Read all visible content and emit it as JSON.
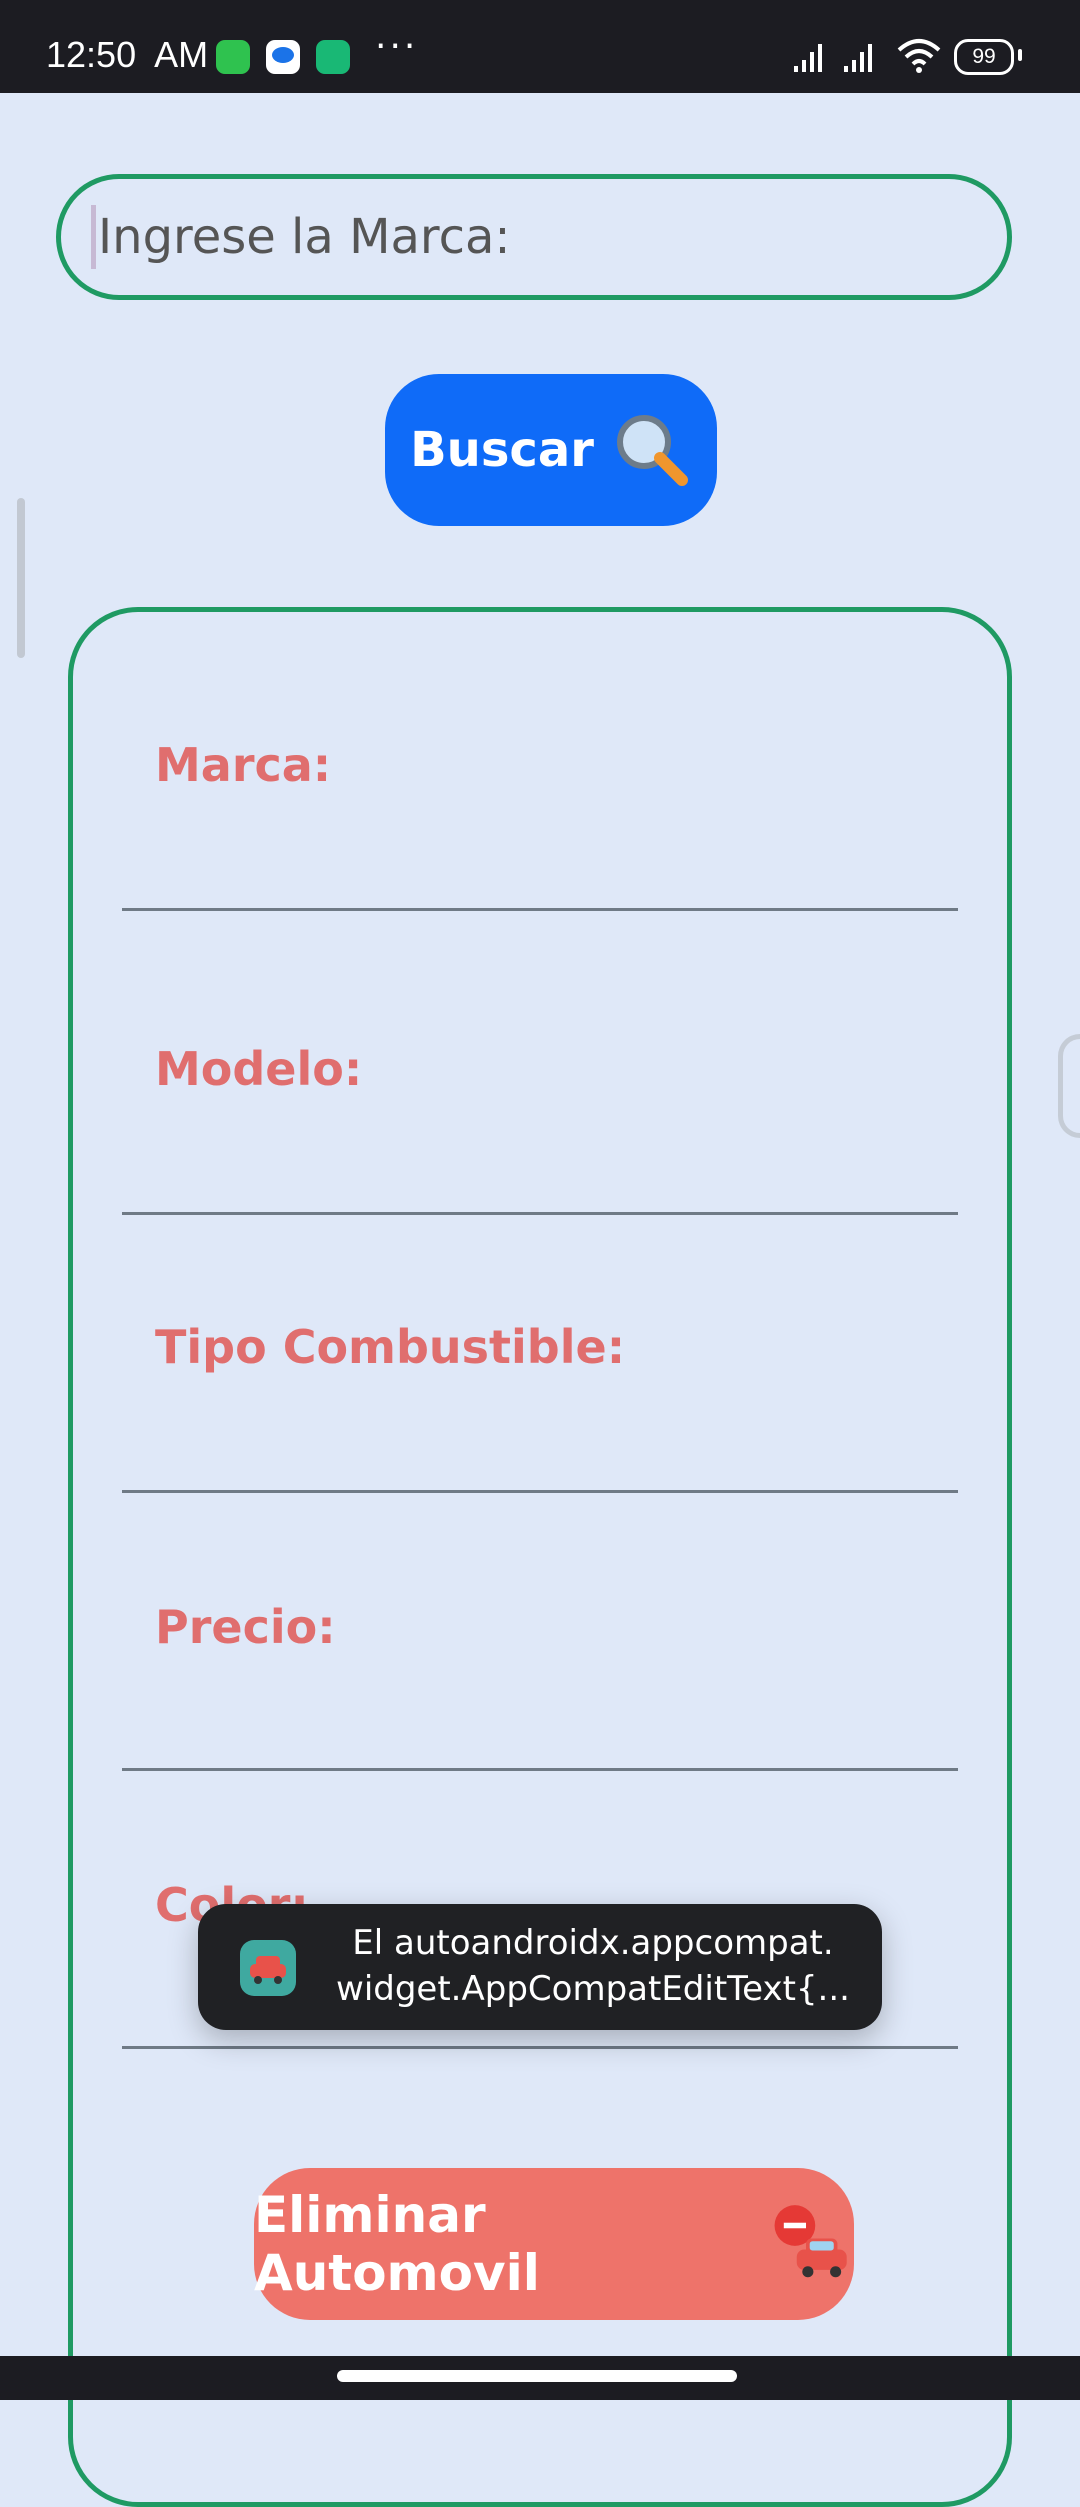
{
  "status_bar": {
    "time": "12:50",
    "ampm": "AM",
    "more": "···",
    "battery": "99"
  },
  "search": {
    "placeholder": "Ingrese la Marca:"
  },
  "buscar_button": {
    "label": "Buscar"
  },
  "fields": [
    {
      "label": "Marca:"
    },
    {
      "label": "Modelo:"
    },
    {
      "label": "Tipo Combustible:"
    },
    {
      "label": "Precio:"
    },
    {
      "label": "Color:"
    }
  ],
  "toast": {
    "line1": "El autoandroidx.appcompat.",
    "line2": "widget.AppCompatEditText{..."
  },
  "delete_button": {
    "label": "Eliminar Automovil"
  },
  "colors": {
    "accent_green": "#1f9a63",
    "button_blue": "#0f6bf8",
    "label_red": "#e06e6e",
    "delete_red": "#ee736a",
    "background": "#dfe8f8"
  }
}
